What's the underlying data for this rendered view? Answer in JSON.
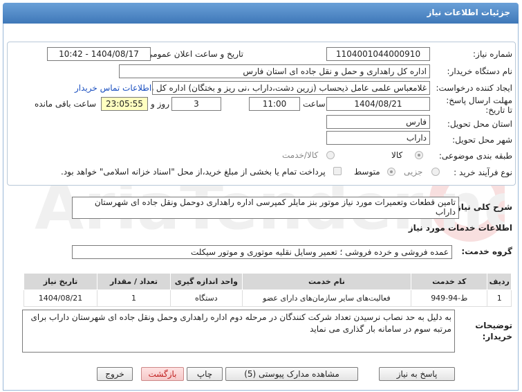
{
  "title": "جزئیات اطلاعات نیاز",
  "need_number": {
    "label": "شماره نیاز:",
    "value": "1104001044000910"
  },
  "announce_datetime": {
    "label": "تاریخ و ساعت اعلان عمومی:",
    "value": "1404/08/17 - 10:42"
  },
  "buyer_org": {
    "label": "نام دستگاه خریدار:",
    "value": "اداره کل راهداری و حمل و نقل جاده ای استان فارس"
  },
  "creator": {
    "label": "ایجاد کننده درخواست:",
    "value": "غلامعباس علمی عامل ذیحساب (زرین دشت،داراب ،نی ریز و بختگان) اداره کل ر",
    "contact_link": "اطلاعات تماس خریدار"
  },
  "deadline": {
    "label": "مهلت ارسال پاسخ: تا تاریخ:",
    "date": "1404/08/21",
    "time_label": "ساعت",
    "time": "11:00",
    "days": "3",
    "days_label": "روز و",
    "remaining": "23:05:55",
    "remaining_label": "ساعت باقی مانده"
  },
  "delivery_province": {
    "label": "استان محل تحویل:",
    "value": "فارس"
  },
  "delivery_city": {
    "label": "شهر محل تحویل:",
    "value": "داراب"
  },
  "category": {
    "label": "طبقه بندی موضوعی:",
    "options": [
      "کالا",
      "کالا/خدمت"
    ]
  },
  "purchase_type": {
    "label": "نوع فرآیند خرید :",
    "options": [
      "جزیی",
      "متوسط"
    ],
    "note": "پرداخت تمام یا بخشی از مبلغ خرید،از محل \"اسناد خزانه اسلامی\" خواهد بود."
  },
  "summary": {
    "label": "شرح کلی نیاز:",
    "value": "تامین قطعات وتعمیرات مورد نیاز موتور بنز مایلر کمپرسی اداره راهداری دوحمل ونقل جاده ای شهرستان داراب"
  },
  "services_heading": "اطلاعات خدمات مورد نیاز",
  "service_group": {
    "label": "گروه خدمت:",
    "value": "عمده فروشی و خرده فروشی ؛ تعمیر وسایل نقلیه موتوری و موتور سیکلت"
  },
  "table": {
    "headers": [
      "ردیف",
      "کد خدمت",
      "نام خدمت",
      "واحد اندازه گیری",
      "تعداد / مقدار",
      "تاریخ نیاز"
    ],
    "rows": [
      [
        "1",
        "ط-94-949",
        "فعالیت‌های سایر سازمان‌های دارای عضو",
        "دستگاه",
        "1",
        "1404/08/21"
      ]
    ]
  },
  "buyer_notes": {
    "label": "توضیحات خریدار:",
    "value": "به دلیل به حد نصاب نرسیدن تعداد شرکت کنندگان در مرحله دوم اداره راهداری وحمل ونقل جاده ای شهرستان داراب برای مرتبه سوم در سامانه بار گذاری می نماید"
  },
  "buttons": {
    "reply": "پاسخ به نیاز",
    "attachments": "مشاهده مدارک پیوستی (5)",
    "print": "چاپ",
    "back": "بازگشت",
    "exit": "خروج"
  },
  "watermark": "AriaTender.net"
}
